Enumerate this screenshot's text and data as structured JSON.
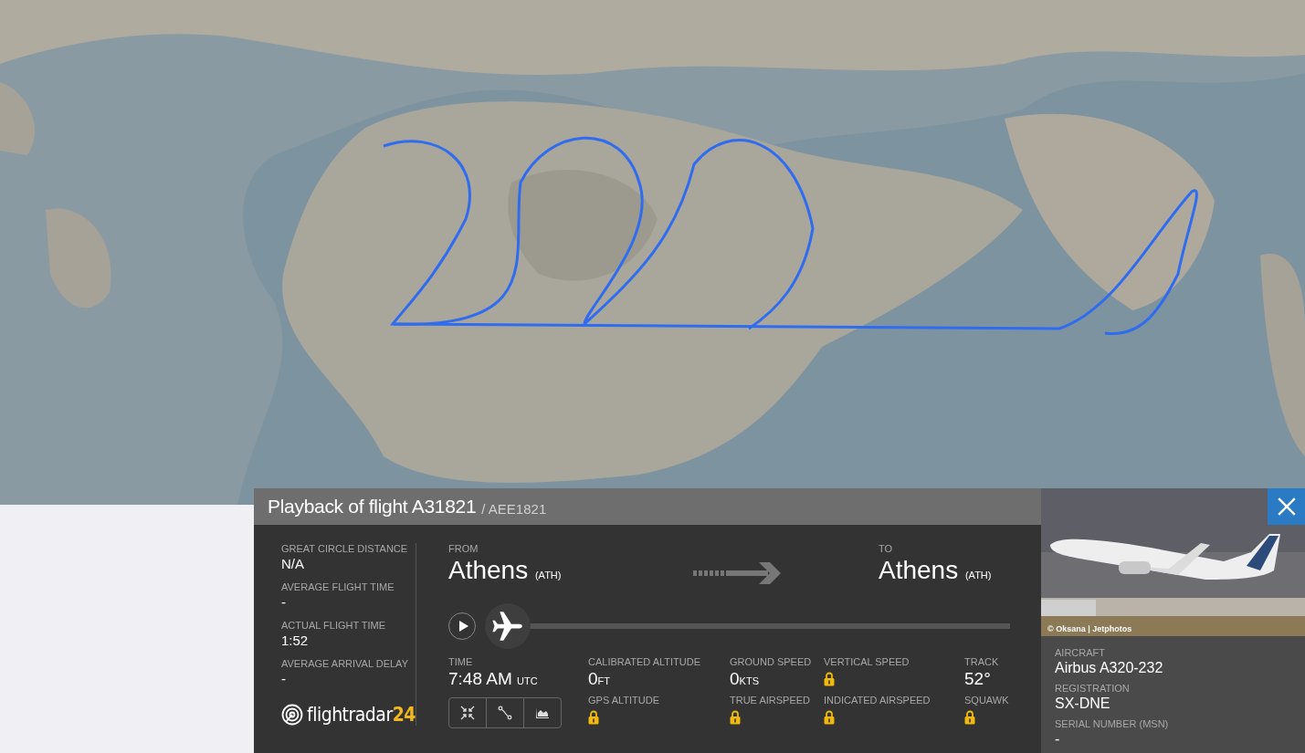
{
  "panel": {
    "title": "Playback of flight A31821",
    "subtitle": "/ AEE1821",
    "summary": [
      {
        "label": "GREAT CIRCLE DISTANCE",
        "value": "N/A"
      },
      {
        "label": "AVERAGE FLIGHT TIME",
        "value": "-"
      },
      {
        "label": "ACTUAL FLIGHT TIME",
        "value": "1:52"
      },
      {
        "label": "AVERAGE ARRIVAL DELAY",
        "value": "-"
      }
    ],
    "logo": {
      "text": "flightradar",
      "number": "24"
    },
    "from": {
      "label": "FROM",
      "city": "Athens",
      "code": "(ATH)"
    },
    "to": {
      "label": "TO",
      "city": "Athens",
      "code": "(ATH)"
    },
    "playback": {
      "level": 0
    },
    "time": {
      "label": "TIME",
      "value": "7:48 AM",
      "unit": "UTC"
    },
    "stats": [
      [
        {
          "label": "CALIBRATED ALTITUDE",
          "value": "0",
          "unit": "FT",
          "locked": false
        },
        {
          "label": "GPS ALTITUDE",
          "locked": true
        }
      ],
      [
        {
          "label": "GROUND SPEED",
          "value": "0",
          "unit": "KTS",
          "locked": false
        },
        {
          "label": "TRUE AIRSPEED",
          "locked": true
        }
      ],
      [
        {
          "label": "VERTICAL SPEED",
          "locked": true
        },
        {
          "label": "INDICATED AIRSPEED",
          "locked": true
        }
      ],
      [
        {
          "label": "TRACK",
          "value": "52°",
          "locked": false
        },
        {
          "label": "SQUAWK",
          "locked": true
        }
      ]
    ],
    "photo": {
      "credit": "© Oksana | Jetphotos"
    },
    "aircraft": [
      {
        "label": "AIRCRAFT",
        "value": "Airbus A320-232"
      },
      {
        "label": "REGISTRATION",
        "value": "SX-DNE"
      },
      {
        "label": "SERIAL NUMBER (MSN)",
        "value": "-"
      }
    ]
  }
}
